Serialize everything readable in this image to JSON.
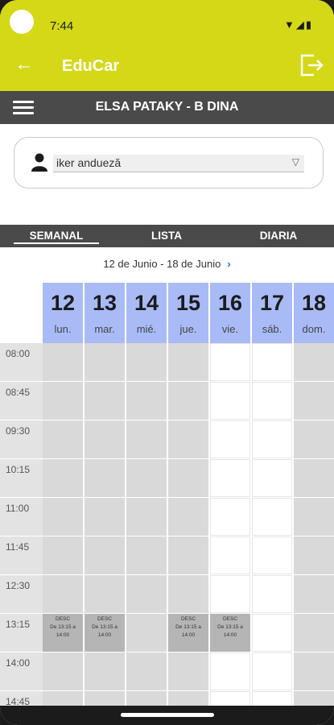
{
  "status_bar": {
    "time": "7:44",
    "icons": [
      "wifi-icon",
      "signal-icon",
      "battery-icon"
    ]
  },
  "app_bar": {
    "title": "EduCar",
    "back_icon": "arrow-left-icon",
    "logout_icon": "logout-icon"
  },
  "user_bar": {
    "name": "ELSA PATAKY - B DINA",
    "menu_icon": "hamburger-icon"
  },
  "selector": {
    "value": "iker andueză",
    "icon": "person-icon"
  },
  "tabs": [
    "SEMANAL",
    "LISTA",
    "DIARIA"
  ],
  "week": {
    "range": "12 de Junio - 18 de Junio",
    "next_icon": "chevron-right-icon"
  },
  "days": [
    {
      "num": "12",
      "name": "lun."
    },
    {
      "num": "13",
      "name": "mar."
    },
    {
      "num": "14",
      "name": "mié."
    },
    {
      "num": "15",
      "name": "jue."
    },
    {
      "num": "16",
      "name": "vie."
    },
    {
      "num": "17",
      "name": "sáb."
    },
    {
      "num": "18",
      "name": "dom."
    }
  ],
  "times": [
    "08:00",
    "08:45",
    "09:30",
    "10:15",
    "11:00",
    "11:45",
    "12:30",
    "13:15",
    "14:00",
    "14:45"
  ],
  "event": {
    "title": "DESC",
    "line1": "De 13:15 a",
    "line2": "14:00"
  },
  "colors": {
    "accent": "#d4d817",
    "header_bar": "#4a4a4a",
    "day_header": "#a9bbf6"
  }
}
